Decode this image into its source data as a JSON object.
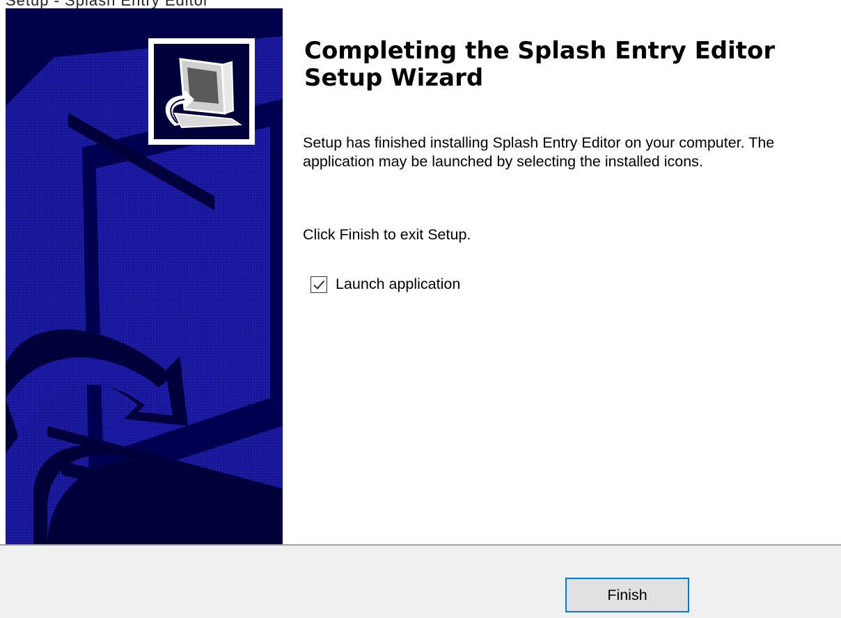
{
  "wizard": {
    "window_title": "Setup - Splash Entry Editor",
    "heading": "Completing the Splash Entry Editor Setup Wizard",
    "description": "Setup has finished installing Splash Entry Editor on your computer. The application may be launched by selecting the installed icons.",
    "finish_hint": "Click Finish to exit Setup.",
    "launch_checkbox": {
      "label": "Launch application",
      "checked": true
    },
    "finish_button_label": "Finish"
  },
  "icons": {
    "installer": "computer-installer-icon",
    "check": "checkmark-icon"
  },
  "colors": {
    "side_panel": "#00004a",
    "side_panel_pattern": "#1a1a9e",
    "footer": "#f0f0f0",
    "button_focus": "#0078d7"
  }
}
